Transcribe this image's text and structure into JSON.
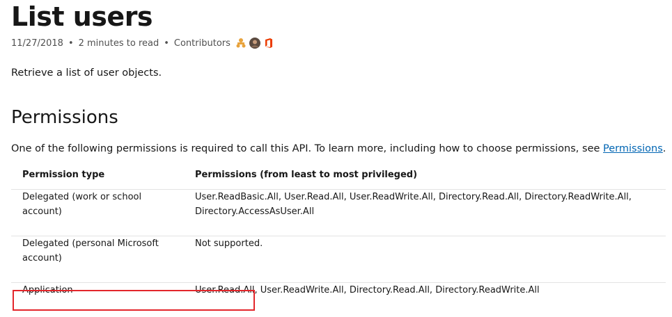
{
  "header": {
    "title": "List users",
    "date": "11/27/2018",
    "read_time": "2 minutes to read",
    "contributors_label": "Contributors",
    "contributor_icons": [
      "contributor-icon-1",
      "contributor-avatar",
      "office-icon"
    ]
  },
  "lead": "Retrieve a list of user objects.",
  "permissions": {
    "heading": "Permissions",
    "intro": "One of the following permissions is required to call this API. To learn more, including how to choose permissions, see ",
    "intro_link": "Permissions",
    "intro_end": ".",
    "table": {
      "headers": [
        "Permission type",
        "Permissions (from least to most privileged)"
      ],
      "rows": [
        {
          "type": "Delegated (work or school account)",
          "perms_line1": "User.ReadBasic.All, User.Read.All, User.ReadWrite.All, Directory.Read.All, Directory.ReadWrite.All,",
          "perms_line2": "Directory.AccessAsUser.All"
        },
        {
          "type_line1": "Delegated (personal Microsoft",
          "type_line2": "account)",
          "perms": "Not supported."
        },
        {
          "type": "Application",
          "perms": "User.Read.All, User.ReadWrite.All, Directory.Read.All, Directory.ReadWrite.All"
        }
      ]
    }
  },
  "colors": {
    "link": "#0065b3",
    "highlight": "#e3262b"
  }
}
